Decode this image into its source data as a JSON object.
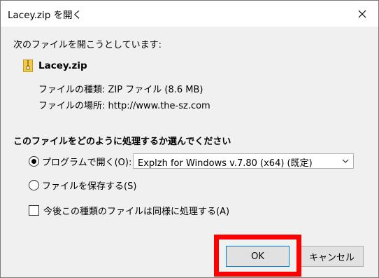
{
  "window": {
    "title": "Lacey.zip を開く"
  },
  "prompt": "次のファイルを開こうとしています:",
  "file": {
    "name": "Lacey.zip",
    "type_label": "ファイルの種類:",
    "type_value": "ZIP ファイル (8.6 MB)",
    "place_label": "ファイルの場所:",
    "place_value": "http://www.the-sz.com"
  },
  "section_title": "このファイルをどのように処理するか選んでください",
  "options": {
    "open_with_label": "プログラムで開く(O):",
    "program_selected": "Explzh for Windows v.7.80 (x64) (既定)",
    "save_label": "ファイルを保存する(S)",
    "remember_label": "今後この種類のファイルは同様に処理する(A)"
  },
  "buttons": {
    "ok": "OK",
    "cancel": "キャンセル"
  },
  "colors": {
    "highlight": "#ff0000",
    "ok_border": "#0078d7"
  }
}
